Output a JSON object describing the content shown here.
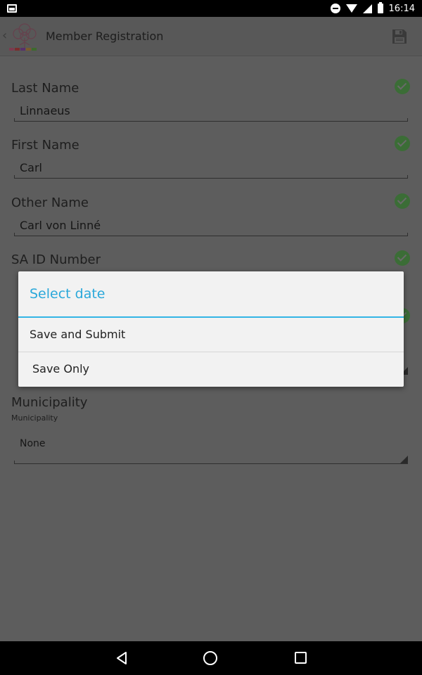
{
  "app": {
    "title": "Member Registration"
  },
  "status_bar": {
    "time": "16:14"
  },
  "form": {
    "fields": [
      {
        "label": "Last Name",
        "value": "Linnaeus"
      },
      {
        "label": "First Name",
        "value": "Carl"
      },
      {
        "label": "Other Name",
        "value": "Carl von Linné"
      },
      {
        "label": "SA ID Number"
      }
    ],
    "municipality": {
      "label": "Municipality",
      "sublabel": "Municipality",
      "value": "None"
    }
  },
  "dialog": {
    "title": "Select date",
    "options": [
      "Save and Submit",
      "Save Only"
    ]
  },
  "colors": {
    "dialog_accent": "#33b5e5",
    "check": "#3b6d36",
    "scrim": "#5d5d5d"
  },
  "icons": {
    "logo": "tree-logo-icon",
    "save": "floppy-disk-icon",
    "check": "check-circle-icon"
  }
}
